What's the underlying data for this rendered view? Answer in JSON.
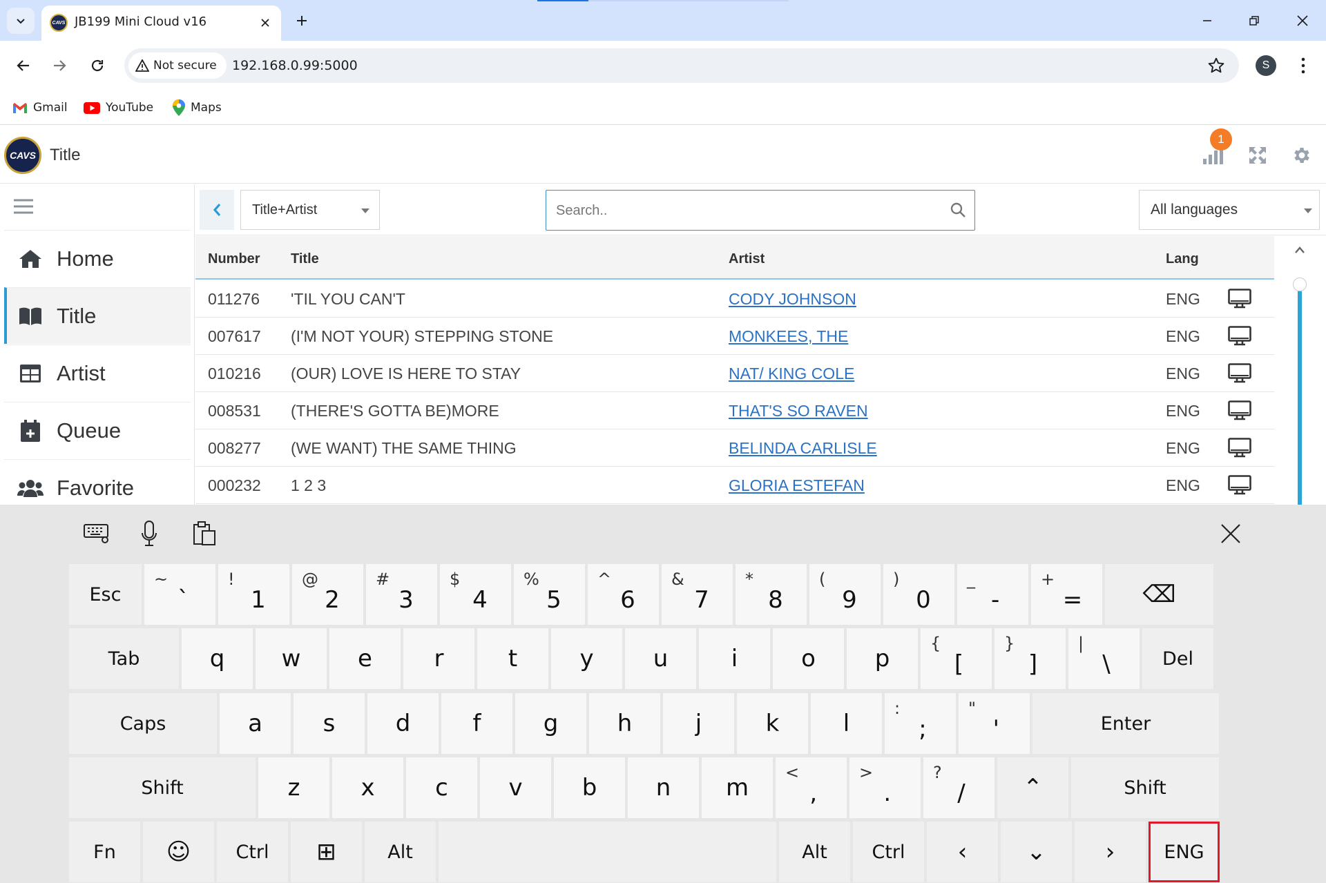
{
  "browser": {
    "tab_title": "JB199 Mini Cloud v16",
    "security_label": "Not secure",
    "url": "192.168.0.99:5000",
    "profile_initial": "S",
    "bookmarks": [
      "Gmail",
      "YouTube",
      "Maps"
    ]
  },
  "app": {
    "logo_text": "CAVS",
    "page_title": "Title",
    "notification_count": "1"
  },
  "sidebar": {
    "items": [
      {
        "label": "Home",
        "icon": "home-icon"
      },
      {
        "label": "Title",
        "icon": "book-icon"
      },
      {
        "label": "Artist",
        "icon": "table-icon"
      },
      {
        "label": "Queue",
        "icon": "calendar-plus-icon"
      },
      {
        "label": "Favorite",
        "icon": "users-icon"
      }
    ],
    "active": "Title"
  },
  "controls": {
    "filter_value": "Title+Artist",
    "search_placeholder": "Search..",
    "search_value": "",
    "language_value": "All languages"
  },
  "table": {
    "headers": {
      "number": "Number",
      "title": "Title",
      "artist": "Artist",
      "lang": "Lang"
    },
    "rows": [
      {
        "number": "011276",
        "title": "'TIL YOU CAN'T",
        "artist": "CODY JOHNSON",
        "lang": "ENG"
      },
      {
        "number": "007617",
        "title": "(I'M NOT YOUR) STEPPING STONE",
        "artist": "MONKEES, THE",
        "lang": "ENG"
      },
      {
        "number": "010216",
        "title": "(OUR) LOVE IS HERE TO STAY",
        "artist": "NAT/ KING COLE",
        "lang": "ENG"
      },
      {
        "number": "008531",
        "title": "(THERE'S GOTTA BE)MORE",
        "artist": "THAT'S SO RAVEN",
        "lang": "ENG"
      },
      {
        "number": "008277",
        "title": "(WE WANT) THE SAME THING",
        "artist": "BELINDA CARLISLE",
        "lang": "ENG"
      },
      {
        "number": "000232",
        "title": "1 2 3",
        "artist": "GLORIA ESTEFAN",
        "lang": "ENG"
      }
    ]
  },
  "keyboard": {
    "row1": [
      {
        "main": "Esc"
      },
      {
        "shift": "~",
        "main": "`"
      },
      {
        "shift": "!",
        "main": "1"
      },
      {
        "shift": "@",
        "main": "2"
      },
      {
        "shift": "#",
        "main": "3"
      },
      {
        "shift": "$",
        "main": "4"
      },
      {
        "shift": "%",
        "main": "5"
      },
      {
        "shift": "^",
        "main": "6"
      },
      {
        "shift": "&",
        "main": "7"
      },
      {
        "shift": "*",
        "main": "8"
      },
      {
        "shift": "(",
        "main": "9"
      },
      {
        "shift": ")",
        "main": "0"
      },
      {
        "shift": "_",
        "main": "-"
      },
      {
        "shift": "+",
        "main": "="
      },
      {
        "main": "⌫"
      }
    ],
    "row2": [
      {
        "main": "Tab"
      },
      {
        "main": "q"
      },
      {
        "main": "w"
      },
      {
        "main": "e"
      },
      {
        "main": "r"
      },
      {
        "main": "t"
      },
      {
        "main": "y"
      },
      {
        "main": "u"
      },
      {
        "main": "i"
      },
      {
        "main": "o"
      },
      {
        "main": "p"
      },
      {
        "shift": "{",
        "main": "["
      },
      {
        "shift": "}",
        "main": "]"
      },
      {
        "shift": "|",
        "main": "\\"
      },
      {
        "main": "Del"
      }
    ],
    "row3": [
      {
        "main": "Caps"
      },
      {
        "main": "a"
      },
      {
        "main": "s"
      },
      {
        "main": "d"
      },
      {
        "main": "f"
      },
      {
        "main": "g"
      },
      {
        "main": "h"
      },
      {
        "main": "j"
      },
      {
        "main": "k"
      },
      {
        "main": "l"
      },
      {
        "shift": ":",
        "main": ";"
      },
      {
        "shift": "\"",
        "main": "'"
      },
      {
        "main": "Enter"
      }
    ],
    "row4": [
      {
        "main": "Shift"
      },
      {
        "main": "z"
      },
      {
        "main": "x"
      },
      {
        "main": "c"
      },
      {
        "main": "v"
      },
      {
        "main": "b"
      },
      {
        "main": "n"
      },
      {
        "main": "m"
      },
      {
        "shift": "<",
        "main": ","
      },
      {
        "shift": ">",
        "main": "."
      },
      {
        "shift": "?",
        "main": "/"
      },
      {
        "main": "⌃"
      },
      {
        "main": "Shift"
      }
    ],
    "row5": [
      {
        "main": "Fn"
      },
      {
        "main": "☺"
      },
      {
        "main": "Ctrl"
      },
      {
        "main": "⊞"
      },
      {
        "main": "Alt"
      },
      {
        "main": ""
      },
      {
        "main": "Alt"
      },
      {
        "main": "Ctrl"
      },
      {
        "main": "‹"
      },
      {
        "main": "⌄"
      },
      {
        "main": "›"
      },
      {
        "main": "ENG"
      }
    ],
    "highlighted_key": "ENG"
  },
  "colors": {
    "accent": "#2a9bd4",
    "link": "#2a72c5",
    "badge": "#f57c26",
    "highlight": "#e0182a"
  }
}
